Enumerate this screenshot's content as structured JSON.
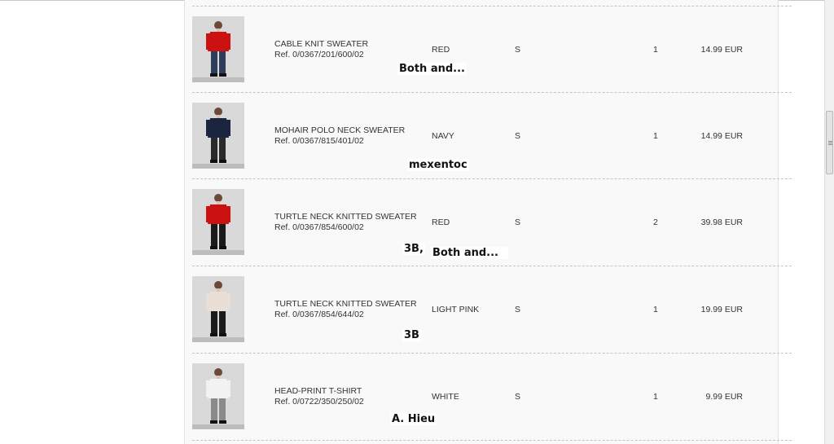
{
  "cart": {
    "items": [
      {
        "name": "CABLE KNIT SWEATER",
        "ref": "Ref. 0/0367/201/600/02",
        "color": "RED",
        "size": "S",
        "qty": "1",
        "price": "14.99 EUR",
        "garment_color": "#cc1111",
        "legwear_color": "#2e3d5c",
        "photo": "product-photo"
      },
      {
        "name": "MOHAIR POLO NECK SWEATER",
        "ref": "Ref. 0/0367/815/401/02",
        "color": "NAVY",
        "size": "S",
        "qty": "1",
        "price": "14.99 EUR",
        "garment_color": "#1c2540",
        "legwear_color": "#2a2a2a",
        "photo": "product-photo"
      },
      {
        "name": "TURTLE NECK KNITTED SWEATER",
        "ref": "Ref. 0/0367/854/600/02",
        "color": "RED",
        "size": "S",
        "qty": "2",
        "price": "39.98 EUR",
        "garment_color": "#cc1111",
        "legwear_color": "#1a1a1a",
        "photo": "product-photo"
      },
      {
        "name": "TURTLE NECK KNITTED SWEATER",
        "ref": "Ref. 0/0367/854/644/02",
        "color": "LIGHT PINK",
        "size": "S",
        "qty": "1",
        "price": "19.99 EUR",
        "garment_color": "#eadfd6",
        "legwear_color": "#1a1a1a",
        "photo": "product-photo"
      },
      {
        "name": "HEAD-PRINT T-SHIRT",
        "ref": "Ref. 0/0722/350/250/02",
        "color": "WHITE",
        "size": "S",
        "qty": "1",
        "price": "9.99 EUR",
        "garment_color": "#f2f2f2",
        "legwear_color": "#8a8a8a",
        "photo": "product-photo"
      }
    ]
  },
  "annotations": {
    "note1": "Both and...",
    "note2": "mexentoc",
    "note3a": "3B,",
    "note3b": "Both and...",
    "note4": "3B",
    "note5": "A. Hieu"
  }
}
